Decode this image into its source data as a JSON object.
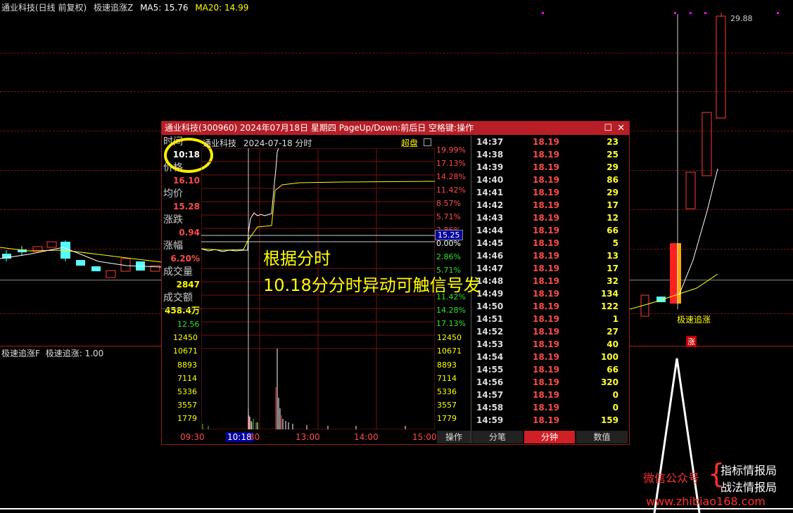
{
  "main_header": {
    "stock": "通业科技(日线 前复权)",
    "indicator": "极速追涨Z",
    "ma5": "MA5: 15.76",
    "ma20": "MA20: 14.99"
  },
  "high_label": "29.88",
  "signal_label": "极速追涨",
  "signal_short": "涨",
  "sub_header": {
    "name": "极速追涨F",
    "value": "极速追涨: 1.00"
  },
  "popup": {
    "title": "通业科技(300960) 2024年07月18日 星期四 PageUp/Down:前后日 空格键:操作",
    "subtitle_name": "通业科技",
    "subtitle_date": "2024-07-18 分时",
    "mode": "超盘",
    "labels": {
      "time": "时间",
      "time_val": "10:18",
      "price": "价格",
      "price_val": "16.10",
      "avg": "均价",
      "avg_val": "15.28",
      "chg": "涨跌",
      "chg_val": "0.94",
      "pct": "涨幅",
      "pct_val": "6.20%",
      "vol": "成交量",
      "vol_val": "2847",
      "amt": "成交额",
      "amt_val": "458.4万"
    },
    "pct_scale_up": [
      "19.99%",
      "17.13%",
      "14.28%",
      "11.42%",
      "8.57%",
      "5.71%",
      "2.86%"
    ],
    "pct_zero": "0.00%",
    "pct_scale_down": [
      "2.86%",
      "5.71%",
      "11.42%",
      "14.28%",
      "17.13%"
    ],
    "price_marker": "15.25",
    "vol_left": [
      "12.56",
      "12450",
      "10671",
      "8893",
      "7114",
      "5336",
      "3557",
      "1779"
    ],
    "vol_right": [
      "12450",
      "10671",
      "8893",
      "7114",
      "5336",
      "3557",
      "1779"
    ],
    "time_axis": [
      "09:30",
      "10:18",
      "30",
      "13:00",
      "14:00",
      "15:00"
    ],
    "op_label": "操作",
    "ticks": [
      {
        "t": "14:37",
        "p": "18.19",
        "v": "23"
      },
      {
        "t": "14:38",
        "p": "18.19",
        "v": "25"
      },
      {
        "t": "14:39",
        "p": "18.19",
        "v": "29"
      },
      {
        "t": "14:40",
        "p": "18.19",
        "v": "86"
      },
      {
        "t": "14:41",
        "p": "18.19",
        "v": "29"
      },
      {
        "t": "14:42",
        "p": "18.19",
        "v": "17"
      },
      {
        "t": "14:43",
        "p": "18.19",
        "v": "12"
      },
      {
        "t": "14:44",
        "p": "18.19",
        "v": "66"
      },
      {
        "t": "14:45",
        "p": "18.19",
        "v": "5"
      },
      {
        "t": "14:46",
        "p": "18.19",
        "v": "13"
      },
      {
        "t": "14:47",
        "p": "18.19",
        "v": "17"
      },
      {
        "t": "14:48",
        "p": "18.19",
        "v": "32"
      },
      {
        "t": "14:49",
        "p": "18.19",
        "v": "134"
      },
      {
        "t": "14:50",
        "p": "18.19",
        "v": "122"
      },
      {
        "t": "14:51",
        "p": "18.19",
        "v": "1"
      },
      {
        "t": "14:52",
        "p": "18.19",
        "v": "27"
      },
      {
        "t": "14:53",
        "p": "18.19",
        "v": "40"
      },
      {
        "t": "14:54",
        "p": "18.19",
        "v": "100"
      },
      {
        "t": "14:55",
        "p": "18.19",
        "v": "66"
      },
      {
        "t": "14:56",
        "p": "18.19",
        "v": "320"
      },
      {
        "t": "14:57",
        "p": "18.19",
        "v": "0"
      },
      {
        "t": "14:58",
        "p": "18.19",
        "v": "0"
      },
      {
        "t": "14:59",
        "p": "18.19",
        "v": "159"
      }
    ],
    "tabs": [
      "分笔",
      "分钟",
      "数值"
    ],
    "active_tab": "分钟"
  },
  "annotation": {
    "line1": "根据分时",
    "line2": "10.18分分时异动可触信号发"
  },
  "watermark": {
    "wechat": "微信公众号",
    "name1": "指标情报局",
    "name2": "战法情报局",
    "url": "www.zhibiao168.com"
  },
  "colors": {
    "up": "#ff3a3a",
    "down": "#54ffff",
    "accent": "#cf2026",
    "yellow": "#ffff00"
  }
}
